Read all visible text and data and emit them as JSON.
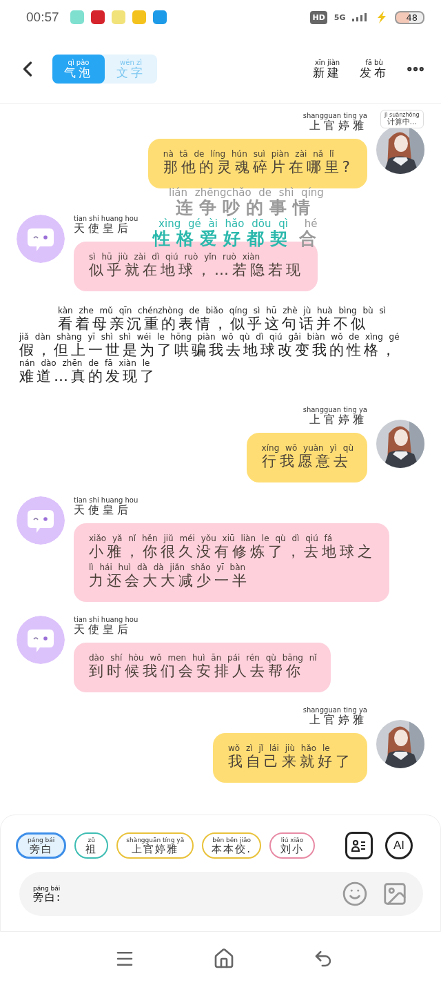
{
  "status_bar": {
    "time": "00:57",
    "hd": "HD",
    "network": "5G",
    "battery": "48"
  },
  "header": {
    "tabs": [
      {
        "label": "气泡",
        "pinyin": "qì pào",
        "selected": true
      },
      {
        "label": "文字",
        "pinyin": "wén zì",
        "selected": false
      }
    ],
    "actions": [
      {
        "label": "新建",
        "pinyin": "xīn jiàn"
      },
      {
        "label": "发布",
        "pinyin": "fā bù"
      }
    ]
  },
  "badge": {
    "label": "计算中...",
    "pinyin": "jì suànzhōng"
  },
  "overlays": [
    {
      "segments": [
        {
          "pinyin": "lián zhēngchǎo de shì qíng",
          "text": "连争吵的事情",
          "highlighted": false
        }
      ]
    },
    {
      "segments": [
        {
          "pinyin": "xìng gé ài hǎo dōu qì",
          "text": "性格爱好都契",
          "highlighted": true
        },
        {
          "pinyin": "hé",
          "text": "合",
          "highlighted": false
        }
      ]
    }
  ],
  "messages": [
    {
      "kind": "right",
      "name": "上官婷雅",
      "name_pinyin": "shangguan ting ya",
      "lines": [
        {
          "pinyin": "nà tā de líng hún suì piàn zài nǎ lǐ",
          "text": "那他的灵魂碎片在哪里?"
        }
      ]
    },
    {
      "kind": "left",
      "name": "天使皇后",
      "name_pinyin": "tian shi huang hou",
      "lines": [
        {
          "pinyin": "sì hū jiù zài dì qiú ruò yǐn ruò xiàn",
          "text": "似乎就在地球，…若隐若现"
        }
      ]
    },
    {
      "kind": "narration",
      "lines": [
        {
          "pinyin": "kàn zhe mǔ qīn chénzhòng de biǎo qíng sì hū zhè jù huà bìng bù sì",
          "text": "看着母亲沉重的表情，似乎这句话并不似"
        },
        {
          "pinyin": "jiǎ dàn shàng yī shì shì wéi le hōng piàn wǒ qù dì qiú gǎi biàn wǒ de xìng gé",
          "text": "假，但上一世是为了哄骗我去地球改变我的性格，"
        },
        {
          "pinyin": "nán dào zhēn de fā xiàn le",
          "text": "难道…真的发现了"
        }
      ]
    },
    {
      "kind": "right",
      "name": "上官婷雅",
      "name_pinyin": "shangguan ting ya",
      "lines": [
        {
          "pinyin": "xíng wǒ yuàn yì qù",
          "text": "行我愿意去"
        }
      ]
    },
    {
      "kind": "left",
      "name": "天使皇后",
      "name_pinyin": "tian shi huang hou",
      "lines": [
        {
          "pinyin": "xiǎo yǎ nǐ hěn jiǔ méi yǒu xiū liàn le qù dì qiú fá",
          "text": "小雅，你很久没有修炼了，去地球之"
        },
        {
          "pinyin": "lì hái huì dà dà jiǎn shǎo yī bàn",
          "text": "力还会大大减少一半"
        }
      ]
    },
    {
      "kind": "left",
      "name": "天使皇后",
      "name_pinyin": "tian shi huang hou",
      "lines": [
        {
          "pinyin": "dào shí hòu wǒ men huì ān pái rén qù bāng nǐ",
          "text": "到时候我们会安排人去帮你"
        }
      ]
    },
    {
      "kind": "right",
      "name": "上官婷雅",
      "name_pinyin": "shangguan ting ya",
      "lines": [
        {
          "pinyin": "wǒ zì jǐ lái jiù hǎo le",
          "text": "我自己来就好了"
        }
      ]
    }
  ],
  "characters": [
    {
      "label": "旁白",
      "pinyin": "páng bái",
      "color": "#3d8ee8",
      "selected": true
    },
    {
      "label": "祖",
      "pinyin": "zǔ",
      "color": "#3dbdb3",
      "selected": false
    },
    {
      "label": "上官婷雅",
      "pinyin": "shàngguān tíng yǎ",
      "color": "#e9c23a",
      "selected": false
    },
    {
      "label": "本本佼.",
      "pinyin": "běn běn jiǎo",
      "color": "#e9c23a",
      "selected": false
    },
    {
      "label": "刘小",
      "pinyin": "liú xiǎo",
      "color": "#e88aa5",
      "selected": false
    }
  ],
  "ai_button": "AI",
  "input": {
    "label": "旁白:",
    "pinyin": "páng bái"
  }
}
